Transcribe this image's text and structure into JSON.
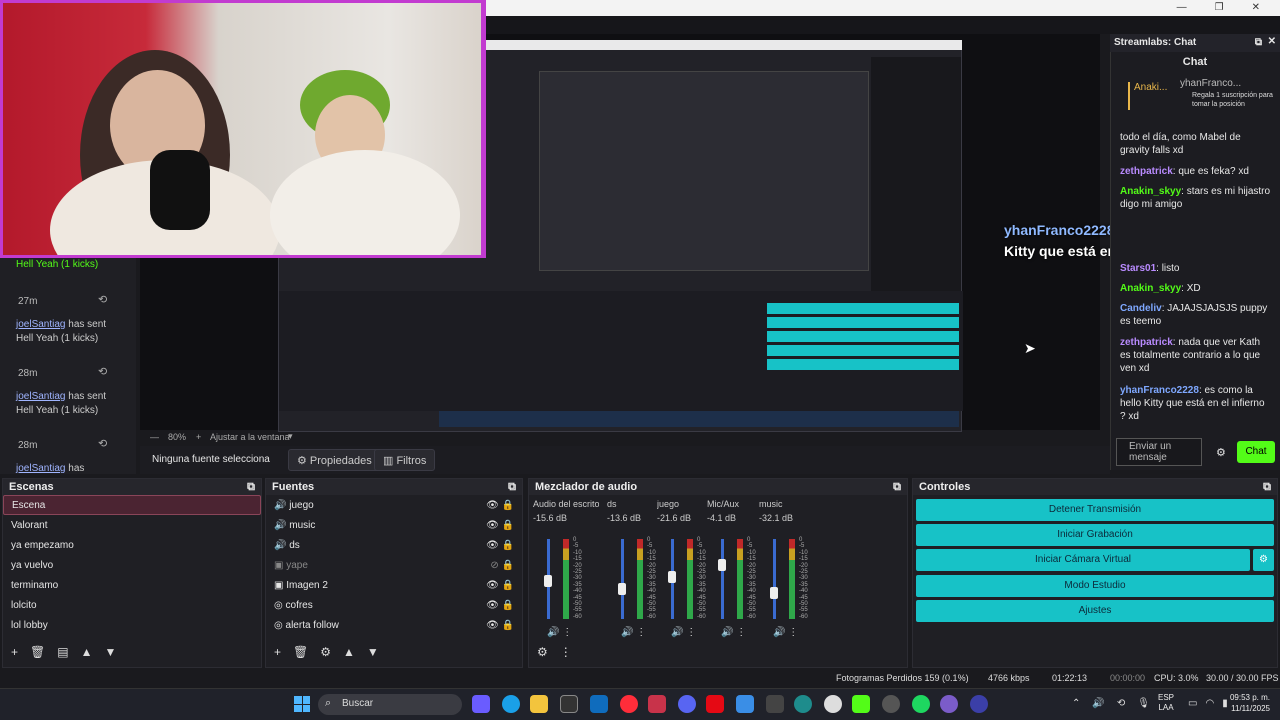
{
  "window": {
    "chat_panel_title": "Streamlabs: Chat"
  },
  "overlay": {
    "user": "yhanFranco2228",
    "text": ": es como la hello Kitty que está en el infierno? xd"
  },
  "left_chat": [
    {
      "user": "",
      "text": "Hell Yeah (1 kicks)",
      "time": "27m"
    },
    {
      "user": "joelSantiag",
      "text": "has sent Hell Yeah (1 kicks)",
      "time": "28m"
    },
    {
      "user": "joelSantiag",
      "text": "has sent Hell Yeah (1 kicks)",
      "time": "28m"
    },
    {
      "user": "joelSantiag",
      "text": "has",
      "time": ""
    }
  ],
  "chat": {
    "title": "Chat",
    "pinned_user": "Anaki...",
    "pinned2_user": "yhanFranco...",
    "pinned2_text": "Regala 1 suscripción para tomar la posición",
    "messages": [
      {
        "user": "",
        "text": "todo el día, como Mabel de gravity falls xd",
        "color": "#e8e8e8"
      },
      {
        "user": "zethpatrick",
        "text": ": que es feka? xd",
        "color": "#b98bff"
      },
      {
        "user": "Anakin_skyy",
        "text": ": stars es mi hijastro digo mi amigo",
        "color": "#53fc18"
      },
      {
        "user": "Stars01",
        "text": ": listo",
        "color": "#b98bff"
      },
      {
        "user": "Anakin_skyy",
        "text": ": XD",
        "color": "#53fc18"
      },
      {
        "user": "Candeliv",
        "text": ": JAJAJSJAJSJS puppy es teemo",
        "color": "#7fa8ff"
      },
      {
        "user": "zethpatrick",
        "text": ": nada que ver Kath es totalmente contrario a lo que ven xd",
        "color": "#b98bff"
      },
      {
        "user": "yhanFranco2228",
        "text": ": es como la hello Kitty que está en el infierno ? xd",
        "color": "#7fa8ff"
      }
    ],
    "input_placeholder": "Enviar un mensaje",
    "send_label": "Chat"
  },
  "preview_bar": {
    "zoom": "80%",
    "fit": "Ajustar a la ventana",
    "source_text": "Ninguna fuente selecciona",
    "properties": "Propiedades",
    "filters": "Filtros"
  },
  "scenes": {
    "title": "Escenas",
    "items": [
      "Escena",
      "Valorant",
      "ya empezamo",
      "ya vuelvo",
      "terminamo",
      "lolcito",
      "lol lobby"
    ]
  },
  "sources": {
    "title": "Fuentes",
    "items": [
      "juego",
      "music",
      "ds",
      "yape",
      "Imagen 2",
      "cofres",
      "alerta follow"
    ]
  },
  "mixer": {
    "title": "Mezclador de audio",
    "channels": [
      {
        "name": "Audio del escritorio",
        "db": "-15.6 dB",
        "level": 0.55
      },
      {
        "name": "ds",
        "db": "-13.6 dB",
        "level": 0.45
      },
      {
        "name": "juego",
        "db": "-21.6 dB",
        "level": 0.6
      },
      {
        "name": "Mic/Aux",
        "db": "-4.1 dB",
        "level": 0.75
      },
      {
        "name": "music",
        "db": "-32.1 dB",
        "level": 0.4
      }
    ],
    "scale": [
      "0",
      "-5",
      "-10",
      "-15",
      "-20",
      "-25",
      "-30",
      "-35",
      "-40",
      "-45",
      "-50",
      "-55",
      "-60"
    ]
  },
  "controls": {
    "title": "Controles",
    "buttons": [
      "Detener Transmisión",
      "Iniciar Grabación",
      "Iniciar Cámara Virtual",
      "Modo Estudio",
      "Ajustes"
    ]
  },
  "status": {
    "dropped": "Fotogramas Perdidos 159 (0.1%)",
    "kbps": "4766 kbps",
    "stream_time": "01:22:13",
    "rec_time": "00:00:00",
    "cpu": "CPU: 3.0%",
    "fps": "30.00 / 30.00 FPS"
  },
  "taskbar": {
    "search": "Buscar",
    "lang": "ESP",
    "lang2": "LAA",
    "time": "09:53 p. m.",
    "date": "11/11/2025"
  },
  "colors": {
    "accent": "#17c2c7",
    "kick": "#53fc18",
    "selected": "#4b2432"
  }
}
